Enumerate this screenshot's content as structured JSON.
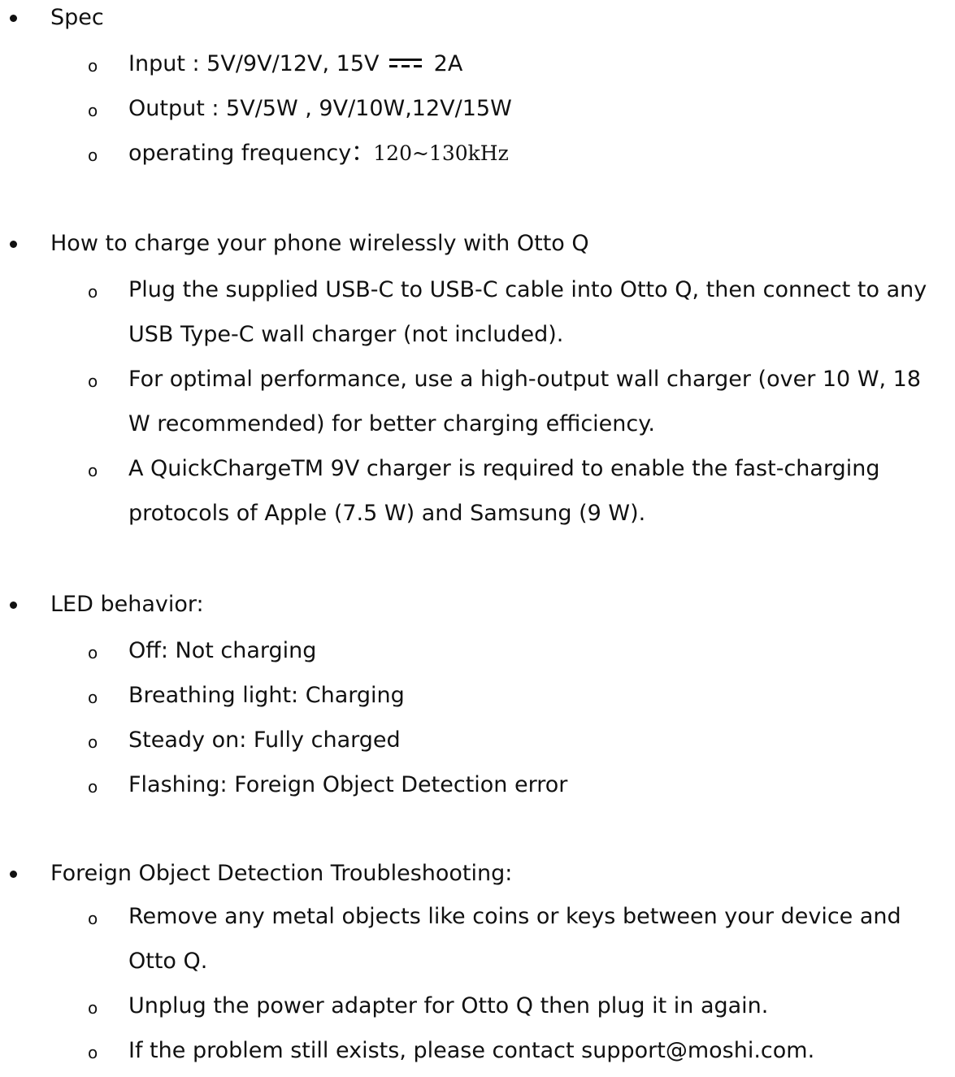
{
  "sections": [
    {
      "heading": "Spec",
      "items": [
        {
          "text_a": "Input : 5V/9V/12V, 15V",
          "symbol": "dc-current-icon",
          "text_b": "2A"
        },
        {
          "text_a": "Output : 5V/5W , 9V/10W,12V/15W"
        },
        {
          "text_a": "operating frequency：",
          "text_serif": "120~130kHz"
        }
      ]
    },
    {
      "heading": "How to charge your phone wirelessly with Otto Q",
      "items": [
        {
          "text_a": "Plug the supplied USB-C to USB-C cable into Otto Q, then connect to any USB Type-C wall charger (not included)."
        },
        {
          "text_a": "For optimal performance, use a high-output wall charger (over 10 W, 18 W recommended) for better charging efficiency."
        },
        {
          "text_a": "A QuickChargeTM 9V charger is required to enable the fast-charging protocols of Apple (7.5 W) and Samsung (9 W)."
        }
      ]
    },
    {
      "heading": "LED behavior:",
      "items": [
        {
          "text_a": "Off: Not charging"
        },
        {
          "text_a": "Breathing light: Charging"
        },
        {
          "text_a": "Steady on: Fully charged"
        },
        {
          "text_a": "Flashing: Foreign Object Detection error"
        }
      ]
    },
    {
      "heading": "Foreign Object Detection Troubleshooting:",
      "items": [
        {
          "text_a": "Remove any metal objects like coins or keys between your device and Otto Q."
        },
        {
          "text_a": "Unplug the power adapter for Otto Q then plug it in again."
        },
        {
          "text_a": "If the problem still exists, please contact support@moshi.com."
        }
      ]
    }
  ],
  "markers": {
    "bullet": "•",
    "sub": "o"
  }
}
